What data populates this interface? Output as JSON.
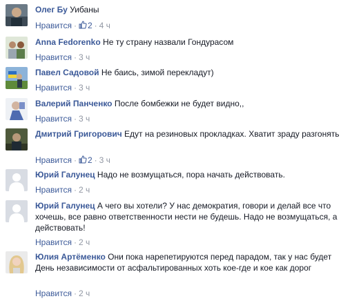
{
  "like_label": "Нравится",
  "separator": "·",
  "comments": [
    {
      "author": "Олег Бу",
      "text": "Уибаны",
      "likes": "2",
      "time": "4 ч"
    },
    {
      "author": "Anna Fedorenko",
      "text": "Не ту страну назвали Гондурасом",
      "likes": "",
      "time": "3 ч"
    },
    {
      "author": "Павел Садовой",
      "text": "Не баись, зимой перекладут)",
      "likes": "",
      "time": "3 ч"
    },
    {
      "author": "Валерий Панченко",
      "text": "После бомбежки не будет видно,,",
      "likes": "",
      "time": "3 ч"
    },
    {
      "author": "Дмитрий Григорович",
      "text": "Едут на резиновых прокладках. Хватит зраду разгонять",
      "likes": "2",
      "time": "3 ч"
    },
    {
      "author": "Юрий Галунец",
      "text": "Надо не возмущаться, пора начать действовать.",
      "likes": "",
      "time": "2 ч"
    },
    {
      "author": "Юрий Галунец",
      "text": "А чего вы хотели? У нас демократия, говори и делай все что хочешь, все равно ответственности нести не будешь. Надо не возмущаться, а действовать!",
      "likes": "",
      "time": "2 ч"
    },
    {
      "author": "Юлия Артёменко",
      "text": "Они пока нарепетируются перед парадом, так у нас будет День независимости от асфальтированных хоть кое-где и кое как дорог",
      "likes": "",
      "time": "2 ч"
    }
  ]
}
